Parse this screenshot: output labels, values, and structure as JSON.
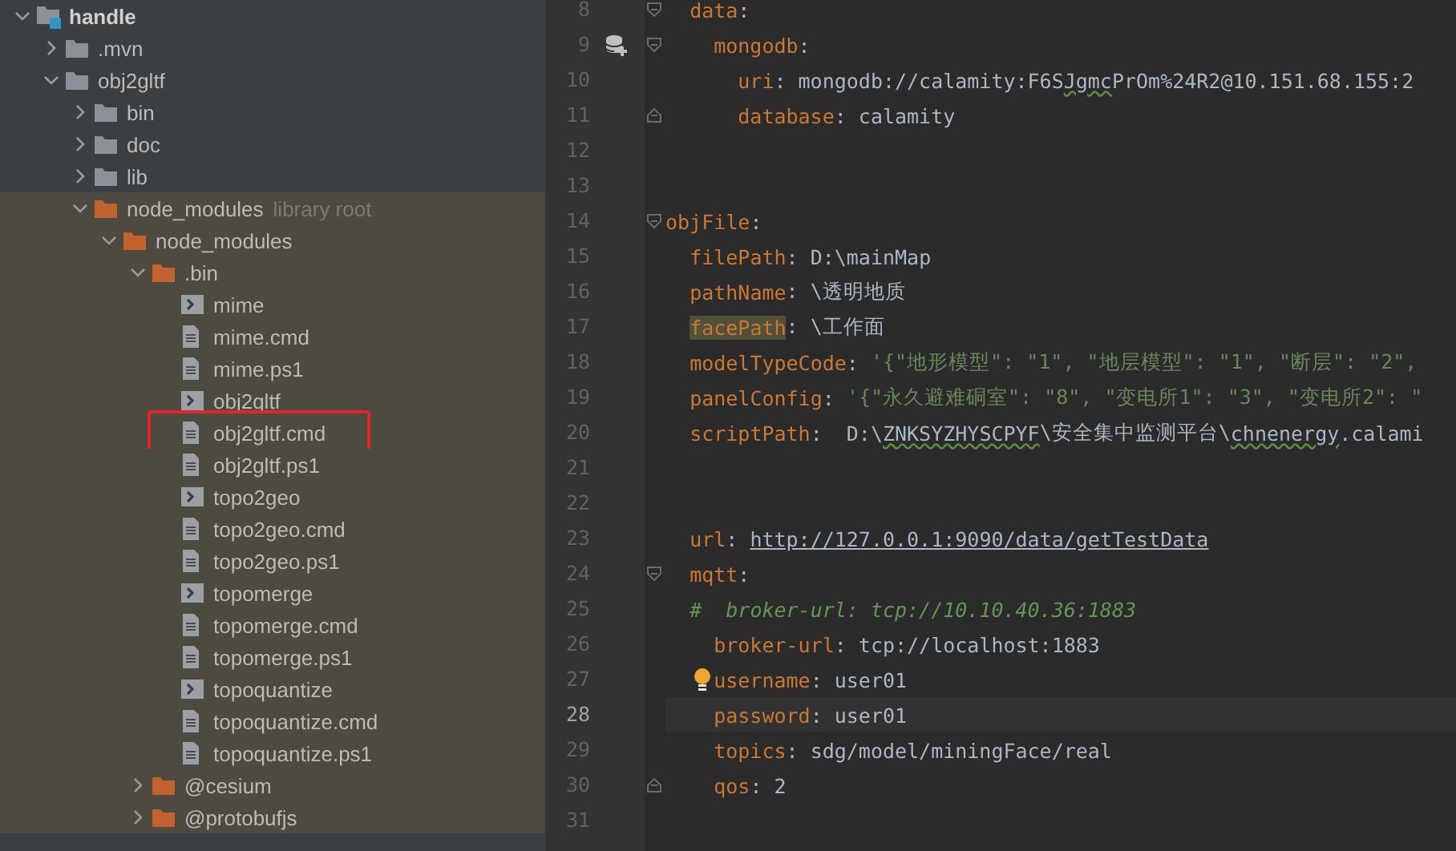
{
  "project_tree": {
    "items": [
      {
        "label": "handle",
        "kind": "module-folder",
        "expanded": true,
        "highlighted": false,
        "children": [
          {
            "label": ".mvn",
            "kind": "folder",
            "expanded": false,
            "highlighted": false
          },
          {
            "label": "obj2gltf",
            "kind": "folder",
            "expanded": true,
            "highlighted": false,
            "children": [
              {
                "label": "bin",
                "kind": "folder",
                "expanded": false,
                "highlighted": false
              },
              {
                "label": "doc",
                "kind": "folder",
                "expanded": false,
                "highlighted": false
              },
              {
                "label": "lib",
                "kind": "folder",
                "expanded": false,
                "highlighted": false
              },
              {
                "label": "node_modules",
                "hint": "library root",
                "kind": "library-folder",
                "expanded": true,
                "highlighted": false,
                "children": [
                  {
                    "label": "node_modules",
                    "kind": "library-folder",
                    "expanded": true,
                    "highlighted": false,
                    "children": [
                      {
                        "label": ".bin",
                        "kind": "library-folder",
                        "expanded": true,
                        "highlighted": false,
                        "children": [
                          {
                            "label": "mime",
                            "kind": "script-file",
                            "highlighted": false
                          },
                          {
                            "label": "mime.cmd",
                            "kind": "text-file",
                            "highlighted": false
                          },
                          {
                            "label": "mime.ps1",
                            "kind": "text-file",
                            "highlighted": false
                          },
                          {
                            "label": "obj2gltf",
                            "kind": "script-file",
                            "highlighted": false
                          },
                          {
                            "label": "obj2gltf.cmd",
                            "kind": "text-file",
                            "highlighted": true
                          },
                          {
                            "label": "obj2gltf.ps1",
                            "kind": "text-file",
                            "highlighted": false
                          },
                          {
                            "label": "topo2geo",
                            "kind": "script-file",
                            "highlighted": false
                          },
                          {
                            "label": "topo2geo.cmd",
                            "kind": "text-file",
                            "highlighted": false
                          },
                          {
                            "label": "topo2geo.ps1",
                            "kind": "text-file",
                            "highlighted": false
                          },
                          {
                            "label": "topomerge",
                            "kind": "script-file",
                            "highlighted": false
                          },
                          {
                            "label": "topomerge.cmd",
                            "kind": "text-file",
                            "highlighted": false
                          },
                          {
                            "label": "topomerge.ps1",
                            "kind": "text-file",
                            "highlighted": false
                          },
                          {
                            "label": "topoquantize",
                            "kind": "script-file",
                            "highlighted": false
                          },
                          {
                            "label": "topoquantize.cmd",
                            "kind": "text-file",
                            "highlighted": false
                          },
                          {
                            "label": "topoquantize.ps1",
                            "kind": "text-file",
                            "highlighted": false
                          }
                        ]
                      },
                      {
                        "label": "@cesium",
                        "kind": "library-folder",
                        "expanded": false,
                        "highlighted": false
                      },
                      {
                        "label": "@protobufjs",
                        "kind": "library-folder",
                        "expanded": false,
                        "highlighted": false
                      }
                    ]
                  }
                ]
              }
            ]
          }
        ]
      }
    ]
  },
  "editor": {
    "lines": [
      {
        "number": "8",
        "current": false,
        "fold": {
          "kind": "start"
        },
        "tokens": [
          {
            "kind": "key",
            "text": "  data"
          },
          {
            "kind": "text",
            "text": ":"
          }
        ]
      },
      {
        "number": "9",
        "current": false,
        "fold": {
          "kind": "start"
        },
        "gutter": {
          "kind": "database"
        },
        "tokens": [
          {
            "kind": "key",
            "text": "    mongodb"
          },
          {
            "kind": "text",
            "text": ":"
          }
        ]
      },
      {
        "number": "10",
        "current": false,
        "tokens": [
          {
            "kind": "key",
            "text": "      uri"
          },
          {
            "kind": "text",
            "text": ": mongodb://calamity:F6S"
          },
          {
            "kind": "typo",
            "text": "Jgmc"
          },
          {
            "kind": "text",
            "text": "PrOm%24R2@10.151.68.155:2"
          }
        ]
      },
      {
        "number": "11",
        "current": false,
        "fold": {
          "kind": "end"
        },
        "tokens": [
          {
            "kind": "key",
            "text": "      database"
          },
          {
            "kind": "text",
            "text": ": calamity"
          }
        ]
      },
      {
        "number": "12",
        "current": false
      },
      {
        "number": "13",
        "current": false
      },
      {
        "number": "14",
        "current": false,
        "fold": {
          "kind": "start"
        },
        "tokens": [
          {
            "kind": "key",
            "text": "objFile"
          },
          {
            "kind": "text",
            "text": ":"
          }
        ]
      },
      {
        "number": "15",
        "current": false,
        "tokens": [
          {
            "kind": "key",
            "text": "  filePath"
          },
          {
            "kind": "text",
            "text": ": D:\\mainMap"
          }
        ]
      },
      {
        "number": "16",
        "current": false,
        "tokens": [
          {
            "kind": "key",
            "text": "  pathName"
          },
          {
            "kind": "text",
            "text": ": \\透明地质"
          }
        ]
      },
      {
        "number": "17",
        "current": false,
        "tokens": [
          {
            "kind": "key-highlight",
            "text": "  facePath"
          },
          {
            "kind": "text",
            "text": ": \\工作面"
          }
        ]
      },
      {
        "number": "18",
        "current": false,
        "tokens": [
          {
            "kind": "key",
            "text": "  modelTypeCode"
          },
          {
            "kind": "text",
            "text": ": "
          },
          {
            "kind": "string",
            "text": "'{\"地形模型\": \"1\", \"地层模型\": \"1\", \"断层\": \"2\","
          }
        ]
      },
      {
        "number": "19",
        "current": false,
        "tokens": [
          {
            "kind": "key",
            "text": "  panelConfig"
          },
          {
            "kind": "text",
            "text": ": "
          },
          {
            "kind": "string",
            "text": "'{\"永久避难硐室\": \"8\", \"变电所1\": \"3\", \"变电所2\": \""
          }
        ]
      },
      {
        "number": "20",
        "current": false,
        "tokens": [
          {
            "kind": "key",
            "text": "  scriptPath"
          },
          {
            "kind": "text",
            "text": ":  D:\\"
          },
          {
            "kind": "typo",
            "text": "ZNKSYZHYSCPYF"
          },
          {
            "kind": "text",
            "text": "\\安全集中监测平台\\"
          },
          {
            "kind": "typo",
            "text": "chnenergy"
          },
          {
            "kind": "text",
            "text": ".calami"
          }
        ]
      },
      {
        "number": "21",
        "current": false
      },
      {
        "number": "22",
        "current": false
      },
      {
        "number": "23",
        "current": false,
        "tokens": [
          {
            "kind": "key",
            "text": "  url"
          },
          {
            "kind": "text",
            "text": ": "
          },
          {
            "kind": "link",
            "text": "http://127.0.0.1:9090/data/getTestData"
          }
        ]
      },
      {
        "number": "24",
        "current": false,
        "fold": {
          "kind": "start"
        },
        "tokens": [
          {
            "kind": "key",
            "text": "  mqtt"
          },
          {
            "kind": "text",
            "text": ":"
          }
        ]
      },
      {
        "number": "25",
        "current": false,
        "tokens": [
          {
            "kind": "comment",
            "text": "  #  broker-url: tcp://10.10.40.36:1883"
          }
        ]
      },
      {
        "number": "26",
        "current": false,
        "tokens": [
          {
            "kind": "key",
            "text": "    broker-url"
          },
          {
            "kind": "text",
            "text": ": tcp://localhost:1883"
          }
        ]
      },
      {
        "number": "27",
        "current": false,
        "gutter": {
          "kind": "bulb"
        },
        "tokens": [
          {
            "kind": "key",
            "text": "    username"
          },
          {
            "kind": "text",
            "text": ": user01"
          }
        ]
      },
      {
        "number": "28",
        "current": true,
        "tokens": [
          {
            "kind": "key",
            "text": "    password"
          },
          {
            "kind": "text",
            "text": ": user01"
          }
        ]
      },
      {
        "number": "29",
        "current": false,
        "tokens": [
          {
            "kind": "key",
            "text": "    topics"
          },
          {
            "kind": "text",
            "text": ": sdg/model/miningFace/real"
          }
        ]
      },
      {
        "number": "30",
        "current": false,
        "fold": {
          "kind": "end"
        },
        "tokens": [
          {
            "kind": "key",
            "text": "    qos"
          },
          {
            "kind": "text",
            "text": ": 2"
          }
        ]
      },
      {
        "number": "31",
        "current": false
      }
    ]
  }
}
